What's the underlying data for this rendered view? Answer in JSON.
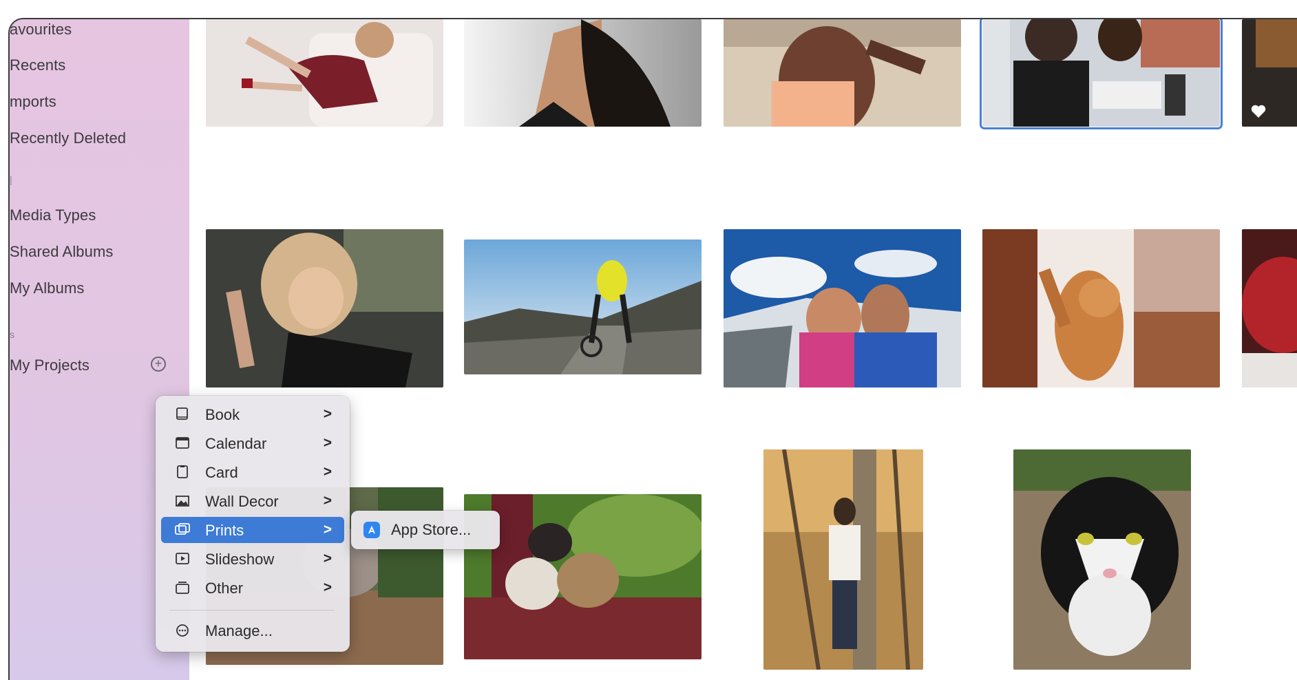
{
  "sidebar": {
    "items": [
      {
        "label": "avourites"
      },
      {
        "label": "Recents"
      },
      {
        "label": "mports"
      },
      {
        "label": "Recently Deleted"
      },
      {
        "label": "Media Types"
      },
      {
        "label": "Shared Albums"
      },
      {
        "label": "My Albums"
      },
      {
        "label": "My Projects"
      }
    ],
    "add_icon": "plus-circle-icon"
  },
  "context_menu": {
    "items": [
      {
        "label": "Book",
        "icon": "book-icon",
        "has_submenu": true
      },
      {
        "label": "Calendar",
        "icon": "calendar-icon",
        "has_submenu": true
      },
      {
        "label": "Card",
        "icon": "card-icon",
        "has_submenu": true
      },
      {
        "label": "Wall Decor",
        "icon": "wall-decor-icon",
        "has_submenu": true
      },
      {
        "label": "Prints",
        "icon": "prints-icon",
        "has_submenu": true,
        "highlighted": true
      },
      {
        "label": "Slideshow",
        "icon": "slideshow-icon",
        "has_submenu": true
      },
      {
        "label": "Other",
        "icon": "other-icon",
        "has_submenu": true
      }
    ],
    "manage": {
      "label": "Manage...",
      "icon": "more-circle-icon"
    },
    "chevron": ">"
  },
  "submenu": {
    "label": "App Store...",
    "icon": "app-store-icon"
  },
  "photos": [
    {
      "name": "woman-red-dress-chair",
      "selected": false,
      "favorite": false
    },
    {
      "name": "woman-black-dress-back",
      "selected": false,
      "favorite": false
    },
    {
      "name": "runner-beach",
      "selected": false,
      "favorite": false
    },
    {
      "name": "two-women-selfie",
      "selected": true,
      "favorite": false
    },
    {
      "name": "partial-photo-row1",
      "selected": false,
      "favorite": true
    },
    {
      "name": "woman-blonde-night",
      "selected": false,
      "favorite": false
    },
    {
      "name": "cyclist-mountain-road",
      "selected": false,
      "favorite": false
    },
    {
      "name": "couple-mountain-selfie",
      "selected": false,
      "favorite": false
    },
    {
      "name": "cat-playing",
      "selected": false,
      "favorite": false
    },
    {
      "name": "partial-photo-row2",
      "selected": false,
      "favorite": false
    },
    {
      "name": "cat-on-bench",
      "selected": false,
      "favorite": false
    },
    {
      "name": "kittens-in-box",
      "selected": false,
      "favorite": false
    },
    {
      "name": "woman-forest-reading",
      "selected": false,
      "favorite": false
    },
    {
      "name": "black-white-cat",
      "selected": false,
      "favorite": false
    }
  ],
  "colors": {
    "sidebar_bg": "#e6c5e1",
    "menu_highlight": "#3d7bd6",
    "selection_outline": "#4a7fd6"
  }
}
